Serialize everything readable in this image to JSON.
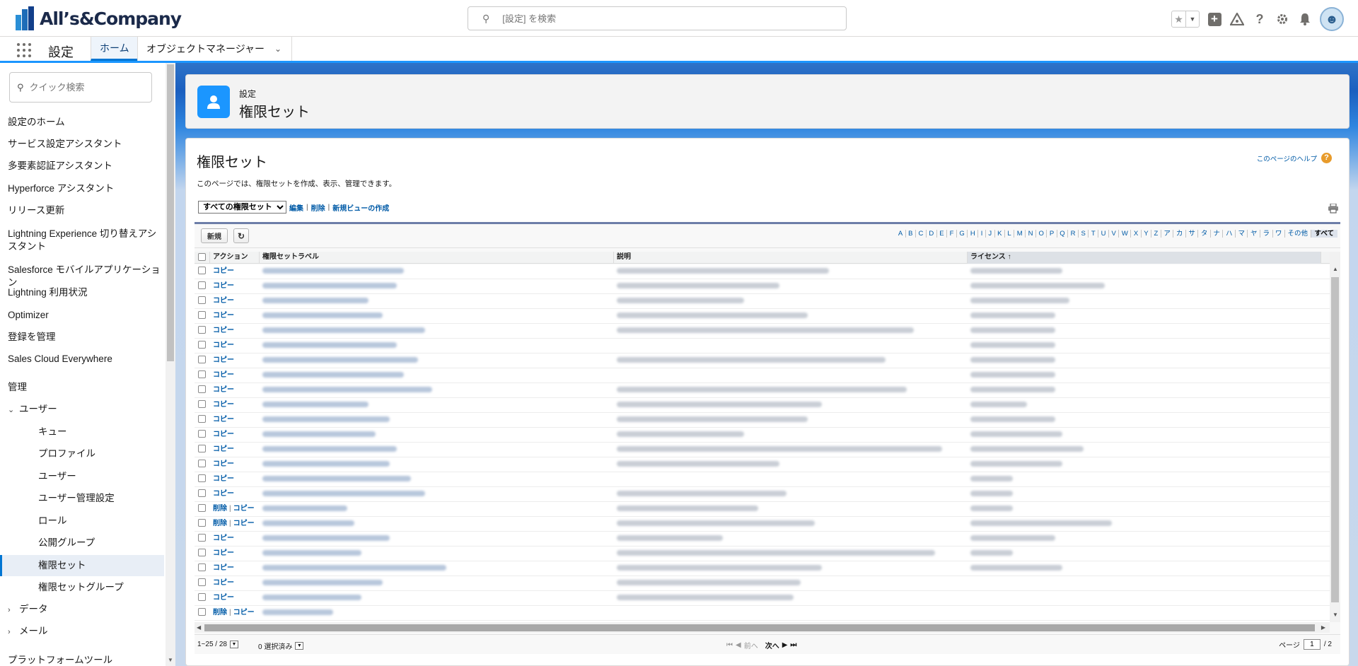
{
  "header": {
    "brand": "All’s&Company",
    "search_placeholder": "[設定] を検索"
  },
  "nav": {
    "app_name": "設定",
    "tab_home": "ホーム",
    "tab_object_manager": "オブジェクトマネージャー"
  },
  "sidebar": {
    "quick_find_placeholder": "クイック検索",
    "items": [
      "設定のホーム",
      "サービス設定アシスタント",
      "多要素認証アシスタント",
      "Hyperforce アシスタント",
      "リリース更新",
      "Lightning Experience 切り替えアシスタント",
      "Salesforce モバイルアプリケーション",
      "Lightning 利用状況",
      "Optimizer",
      "登録を管理",
      "Sales Cloud Everywhere"
    ],
    "section_admin": "管理",
    "group_users": "ユーザー",
    "user_children": [
      "キュー",
      "プロファイル",
      "ユーザー",
      "ユーザー管理設定",
      "ロール",
      "公開グループ",
      "権限セット",
      "権限セットグループ"
    ],
    "group_data": "データ",
    "group_email": "メール",
    "section_platform_tools": "プラットフォームツール"
  },
  "page_header": {
    "breadcrumb": "設定",
    "title": "権限セット"
  },
  "content": {
    "title": "権限セット",
    "help_link": "このページのヘルプ",
    "description": "このページでは、権限セットを作成、表示、管理できます。",
    "view_selected": "すべての権限セット",
    "link_edit": "編集",
    "link_delete": "削除",
    "link_new_view": "新規ビューの作成"
  },
  "list": {
    "new_button": "新規",
    "alphabet": [
      "A",
      "B",
      "C",
      "D",
      "E",
      "F",
      "G",
      "H",
      "I",
      "J",
      "K",
      "L",
      "M",
      "N",
      "O",
      "P",
      "Q",
      "R",
      "S",
      "T",
      "U",
      "V",
      "W",
      "X",
      "Y",
      "Z",
      "ア",
      "カ",
      "サ",
      "タ",
      "ナ",
      "ハ",
      "マ",
      "ヤ",
      "ラ",
      "ワ",
      "その他",
      "すべて"
    ],
    "alphabet_current": "すべて",
    "columns": {
      "action": "アクション",
      "label": "権限セットラベル",
      "description": "説明",
      "license": "ライセンス ↑"
    },
    "row_actions": [
      "copy",
      "copy",
      "copy",
      "copy",
      "copy",
      "copy",
      "copy",
      "copy",
      "copy",
      "copy",
      "copy",
      "copy",
      "copy",
      "copy",
      "copy",
      "copy",
      "delete_copy",
      "delete_copy",
      "copy",
      "copy",
      "copy",
      "copy",
      "copy",
      "delete_copy",
      "copy"
    ],
    "action_copy": "コピー",
    "action_delete": "削除",
    "footer_range": "1~25 / 28",
    "footer_selected": "0 選択済み",
    "footer_prev": "前へ",
    "footer_next": "次へ",
    "footer_page_label": "ページ",
    "footer_page_value": "1",
    "footer_page_total": "/ 2"
  }
}
